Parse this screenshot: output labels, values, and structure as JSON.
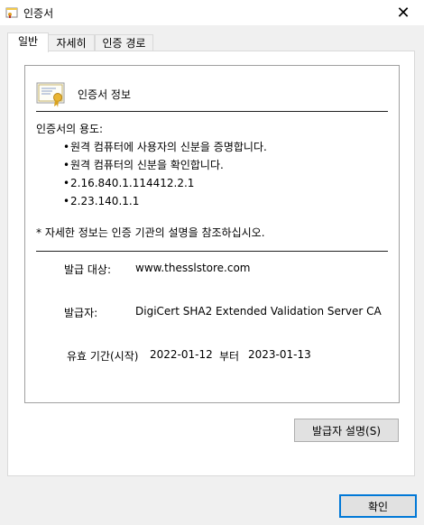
{
  "window": {
    "title": "인증서",
    "close_glyph": "✕"
  },
  "tabs": [
    {
      "label": "일반",
      "active": true
    },
    {
      "label": "자세히",
      "active": false
    },
    {
      "label": "인증 경로",
      "active": false
    }
  ],
  "info": {
    "title": "인증서 정보",
    "purpose_heading": "인증서의 용도:",
    "purposes": [
      "원격 컴퓨터에 사용자의 신분을 증명합니다.",
      "원격 컴퓨터의 신분을 확인합니다.",
      "2.16.840.1.114412.2.1",
      "2.23.140.1.1"
    ],
    "note": "* 자세한 정보는 인증 기관의 설명을 참조하십시오.",
    "issued_to_label": "발급 대상:",
    "issued_to_value": "www.thesslstore.com",
    "issued_by_label": "발급자:",
    "issued_by_value": "DigiCert SHA2 Extended Validation Server CA",
    "validity_label": "유효 기간",
    "validity_label_suffix": "(시작)",
    "valid_from": "2022-01-12",
    "valid_to_word": "부터",
    "valid_to": "2023-01-13"
  },
  "buttons": {
    "issuer_statement": "발급자 설명(S)",
    "ok": "확인"
  },
  "icons": {
    "title": "certificate-icon",
    "info": "certificate-ribbon-icon"
  }
}
